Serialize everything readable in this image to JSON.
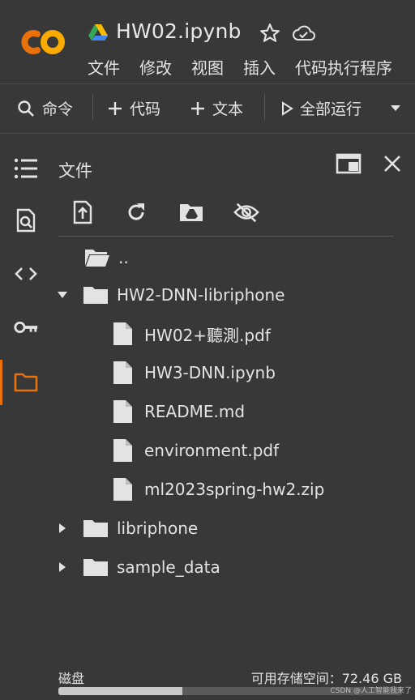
{
  "header": {
    "title": "HW02.ipynb",
    "menu": [
      "文件",
      "修改",
      "视图",
      "插入",
      "代码执行程序"
    ]
  },
  "toolbar": {
    "command_label": "命令",
    "code_label": "代码",
    "text_label": "文本",
    "run_all_label": "全部运行"
  },
  "panel": {
    "title": "文件"
  },
  "files": {
    "parent": "..",
    "folder_open": "HW2-DNN-libriphone",
    "children": [
      "HW02+聽測.pdf",
      "HW3-DNN.ipynb",
      "README.md",
      "environment.pdf",
      "ml2023spring-hw2.zip"
    ],
    "folders": [
      "libriphone",
      "sample_data"
    ]
  },
  "disk": {
    "label": "磁盘",
    "free": "可用存储空间：72.46 GB",
    "used_fraction": 0.36
  },
  "watermark": "CSDN @人工智能我来了",
  "colors": {
    "background": "#383838",
    "accent_orange": "#e8710a",
    "logo_orange": "#f9ab00",
    "text": "#e3e3e3"
  },
  "icons": {
    "sidebar": [
      "toc-icon",
      "find-icon",
      "code-snippets-icon",
      "secrets-key-icon",
      "folder-icon"
    ]
  }
}
